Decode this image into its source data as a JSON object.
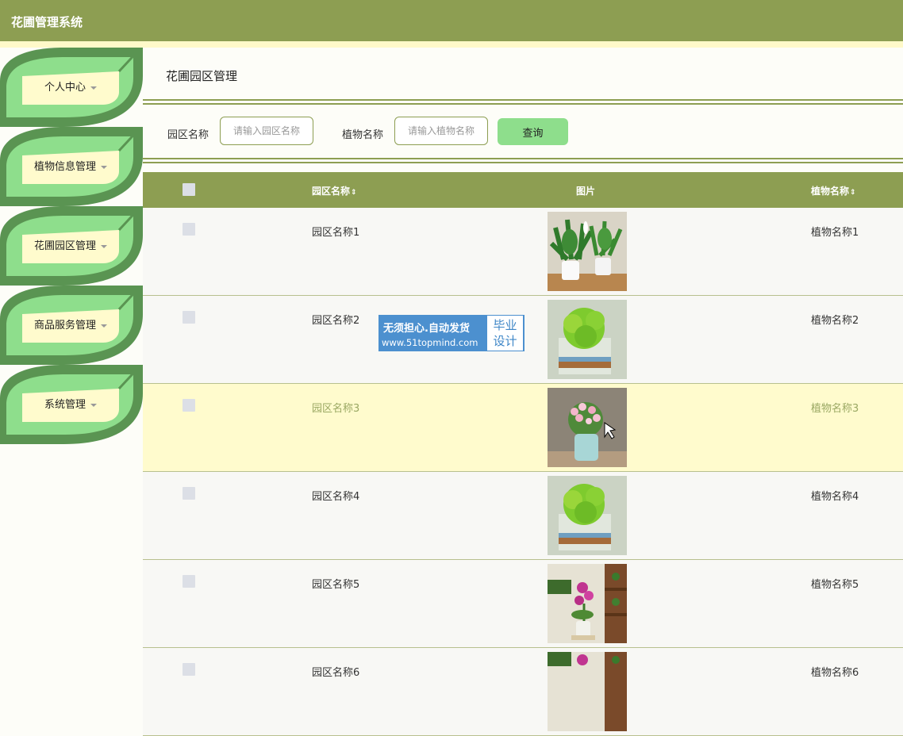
{
  "app": {
    "title": "花圃管理系统"
  },
  "sidebar": {
    "items": [
      {
        "label": "个人中心"
      },
      {
        "label": "植物信息管理"
      },
      {
        "label": "花圃园区管理"
      },
      {
        "label": "商品服务管理"
      },
      {
        "label": "系统管理"
      }
    ]
  },
  "main": {
    "page_title": "花圃园区管理",
    "search": {
      "area_label": "园区名称",
      "area_placeholder": "请输入园区名称",
      "plant_label": "植物名称",
      "plant_placeholder": "请输入植物名称",
      "query_button": "查询"
    },
    "table": {
      "headers": {
        "area": "园区名称",
        "image": "图片",
        "plant": "植物名称"
      },
      "rows": [
        {
          "area": "园区名称1",
          "plant": "植物名称1",
          "image": "white-lily-pots"
        },
        {
          "area": "园区名称2",
          "plant": "植物名称2",
          "image": "green-sprout-glass"
        },
        {
          "area": "园区名称3",
          "plant": "植物名称3",
          "image": "pink-flower-pot"
        },
        {
          "area": "园区名称4",
          "plant": "植物名称4",
          "image": "green-sprout-glass"
        },
        {
          "area": "园区名称5",
          "plant": "植物名称5",
          "image": "orchid-shelf"
        },
        {
          "area": "园区名称6",
          "plant": "植物名称6",
          "image": "orchid-shelf"
        }
      ]
    }
  },
  "watermark": {
    "line1": "无须担心.自动发货",
    "line2": "www.51topmind.com",
    "badge_line1": "毕业",
    "badge_line2": "设计"
  },
  "colors": {
    "topbar": "#8d9e52",
    "accent_green": "#8ede8c",
    "leaf_dark": "#5a9452",
    "highlight_row": "#fffbcd"
  }
}
